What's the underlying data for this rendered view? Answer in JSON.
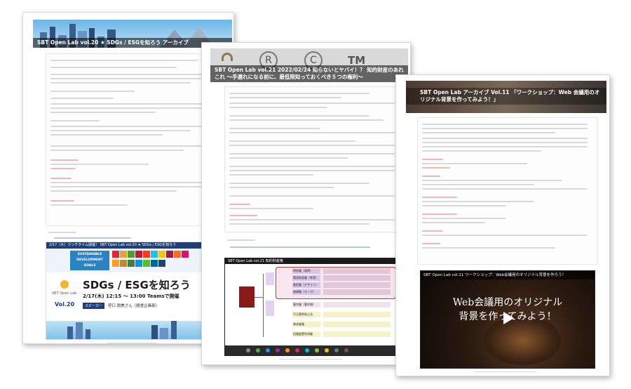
{
  "pages": [
    {
      "banner_title": "SBT Open Lab vol.20 ★ SDGs / ESGを知ろう アーカイブ",
      "promo": {
        "header": "2/17（木）ランチタイム開催！ SBT Open Lab vol.20 ★ SDGs / ESGを知ろう",
        "goals_badge_1": "SUSTAINABLE",
        "goals_badge_2": "DEVELOPMENT",
        "goals_badge_3": "GOALS",
        "logo_text": "SBT Open Lab",
        "vol": "Vol.20",
        "main_title": "SDGs / ESGを知ろう",
        "date": "2/17(木) 12:15 ～ 13:00 Teamsで開催",
        "speaker_label": "スピーカー",
        "speaker_name": "笹口 朋美さん（経営企画部）"
      }
    },
    {
      "banner_title": "SBT Open Lab vol.21 2022/02/24 知らないとヤバイ！？ 知的財産のあれこれ ～手遅れになる前に、最低限知っておくべき５つの権利～",
      "slide_header": "SBT Open Lab vol.21 知的財産権",
      "slide_rows": [
        "特許権（発明）",
        "実用新案権（考案）",
        "意匠権（デザイン）",
        "商標権（マーク）",
        "著作権（著作物）",
        "不正競争防止法",
        "育成者権",
        "回路配置利用権"
      ]
    },
    {
      "banner_title": "SBT Open Lab アーカイブ Vol.11 「ワークショップ：Web 会議用のオリジナル背景を作ってみよう！」",
      "video_header": "SBT Open Lab vol.11 ワークショップ：Web会議用のオリジナル背景を作ろう！",
      "video_title_1": "Web会議用のオリジナル",
      "video_title_2": "背景を作ってみよう！"
    }
  ],
  "colors": {
    "sky": "#6bb5e6",
    "promo_band": "#1d3f7a",
    "goals": "#2b83c4",
    "red_box": "#c0392b",
    "dark": "#1a1a1a"
  }
}
